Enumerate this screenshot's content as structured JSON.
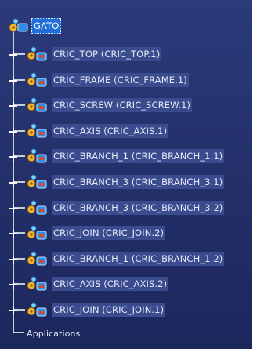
{
  "tree": {
    "root": {
      "label": "GATO",
      "icon": "product-gear-icon"
    },
    "items": [
      {
        "label": "CRIC_TOP (CRIC_TOP.1)",
        "icon": "product-gear-icon",
        "expander": "plus-expander-icon"
      },
      {
        "label": "CRIC_FRAME (CRIC_FRAME.1)",
        "icon": "product-gear-icon",
        "expander": "plus-expander-icon"
      },
      {
        "label": "CRIC_SCREW (CRIC_SCREW.1)",
        "icon": "product-gear-icon",
        "expander": "plus-expander-icon"
      },
      {
        "label": "CRIC_AXIS (CRIC_AXIS.1)",
        "icon": "product-gear-icon",
        "expander": "plus-expander-icon"
      },
      {
        "label": "CRIC_BRANCH_1 (CRIC_BRANCH_1.1)",
        "icon": "product-gear-icon",
        "expander": "plus-expander-icon"
      },
      {
        "label": "CRIC_BRANCH_3 (CRIC_BRANCH_3.1)",
        "icon": "product-gear-icon",
        "expander": "plus-expander-icon"
      },
      {
        "label": "CRIC_BRANCH_3 (CRIC_BRANCH_3.2)",
        "icon": "product-gear-icon",
        "expander": "plus-expander-icon"
      },
      {
        "label": "CRIC_JOIN (CRIC_JOIN.2)",
        "icon": "product-gear-icon",
        "expander": "plus-expander-icon"
      },
      {
        "label": "CRIC_BRANCH_1 (CRIC_BRANCH_1.2)",
        "icon": "product-gear-icon",
        "expander": "plus-expander-icon"
      },
      {
        "label": "CRIC_AXIS (CRIC_AXIS.2)",
        "icon": "product-gear-icon",
        "expander": "plus-expander-icon"
      },
      {
        "label": "CRIC_JOIN (CRIC_JOIN.1)",
        "icon": "product-gear-icon",
        "expander": "plus-expander-icon"
      }
    ],
    "footer": {
      "label": "Applications"
    }
  },
  "colors": {
    "background": "#23306a",
    "text": "#e6e9f8",
    "selection": "#1f6fd6",
    "tree_line": "#ffffff"
  }
}
